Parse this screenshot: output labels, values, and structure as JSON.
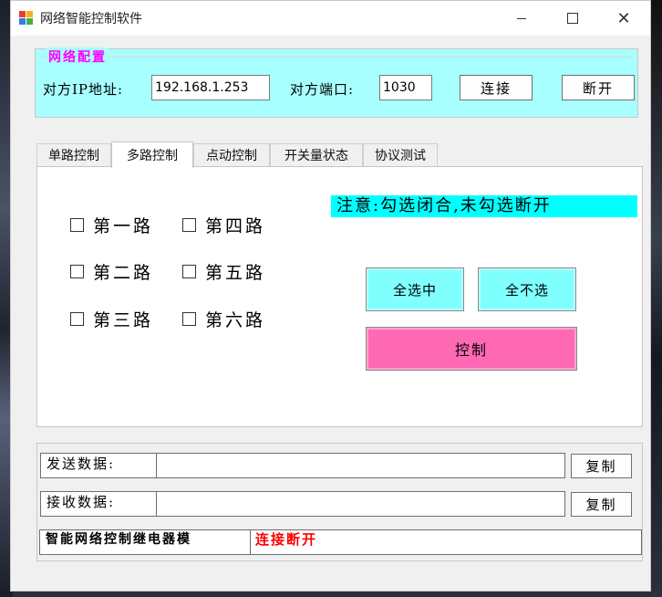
{
  "window": {
    "title": "网络智能控制软件"
  },
  "network": {
    "group_title": "网络配置",
    "ip_label": "对方IP地址:",
    "ip_value": "192.168.1.253",
    "port_label": "对方端口:",
    "port_value": "1030",
    "connect_label": "连接",
    "disconnect_label": "断开"
  },
  "tabs": [
    {
      "label": "单路控制"
    },
    {
      "label": "多路控制",
      "active": true
    },
    {
      "label": "点动控制"
    },
    {
      "label": "开关量状态"
    },
    {
      "label": "协议测试"
    }
  ],
  "multi": {
    "channels": [
      {
        "label": "第一路",
        "checked": false
      },
      {
        "label": "第二路",
        "checked": false
      },
      {
        "label": "第三路",
        "checked": false
      },
      {
        "label": "第四路",
        "checked": false
      },
      {
        "label": "第五路",
        "checked": false
      },
      {
        "label": "第六路",
        "checked": false
      }
    ],
    "notice": "注意:勾选闭合,未勾选断开",
    "select_all": "全选中",
    "select_none": "全不选",
    "control": "控制"
  },
  "data": {
    "send_label": "发送数据:",
    "send_value": "",
    "receive_label": "接收数据:",
    "receive_value": "",
    "copy_label": "复制"
  },
  "status": {
    "device_name": "智能网络控制继电器模",
    "connection": "连接断开",
    "connection_color": "#ff0000"
  },
  "colors": {
    "group_bg": "#a8ffff",
    "group_title": "#ff00ff",
    "notice_bg": "#00ffff",
    "cyan_button": "#80ffff",
    "control_button": "#ff69b4"
  }
}
